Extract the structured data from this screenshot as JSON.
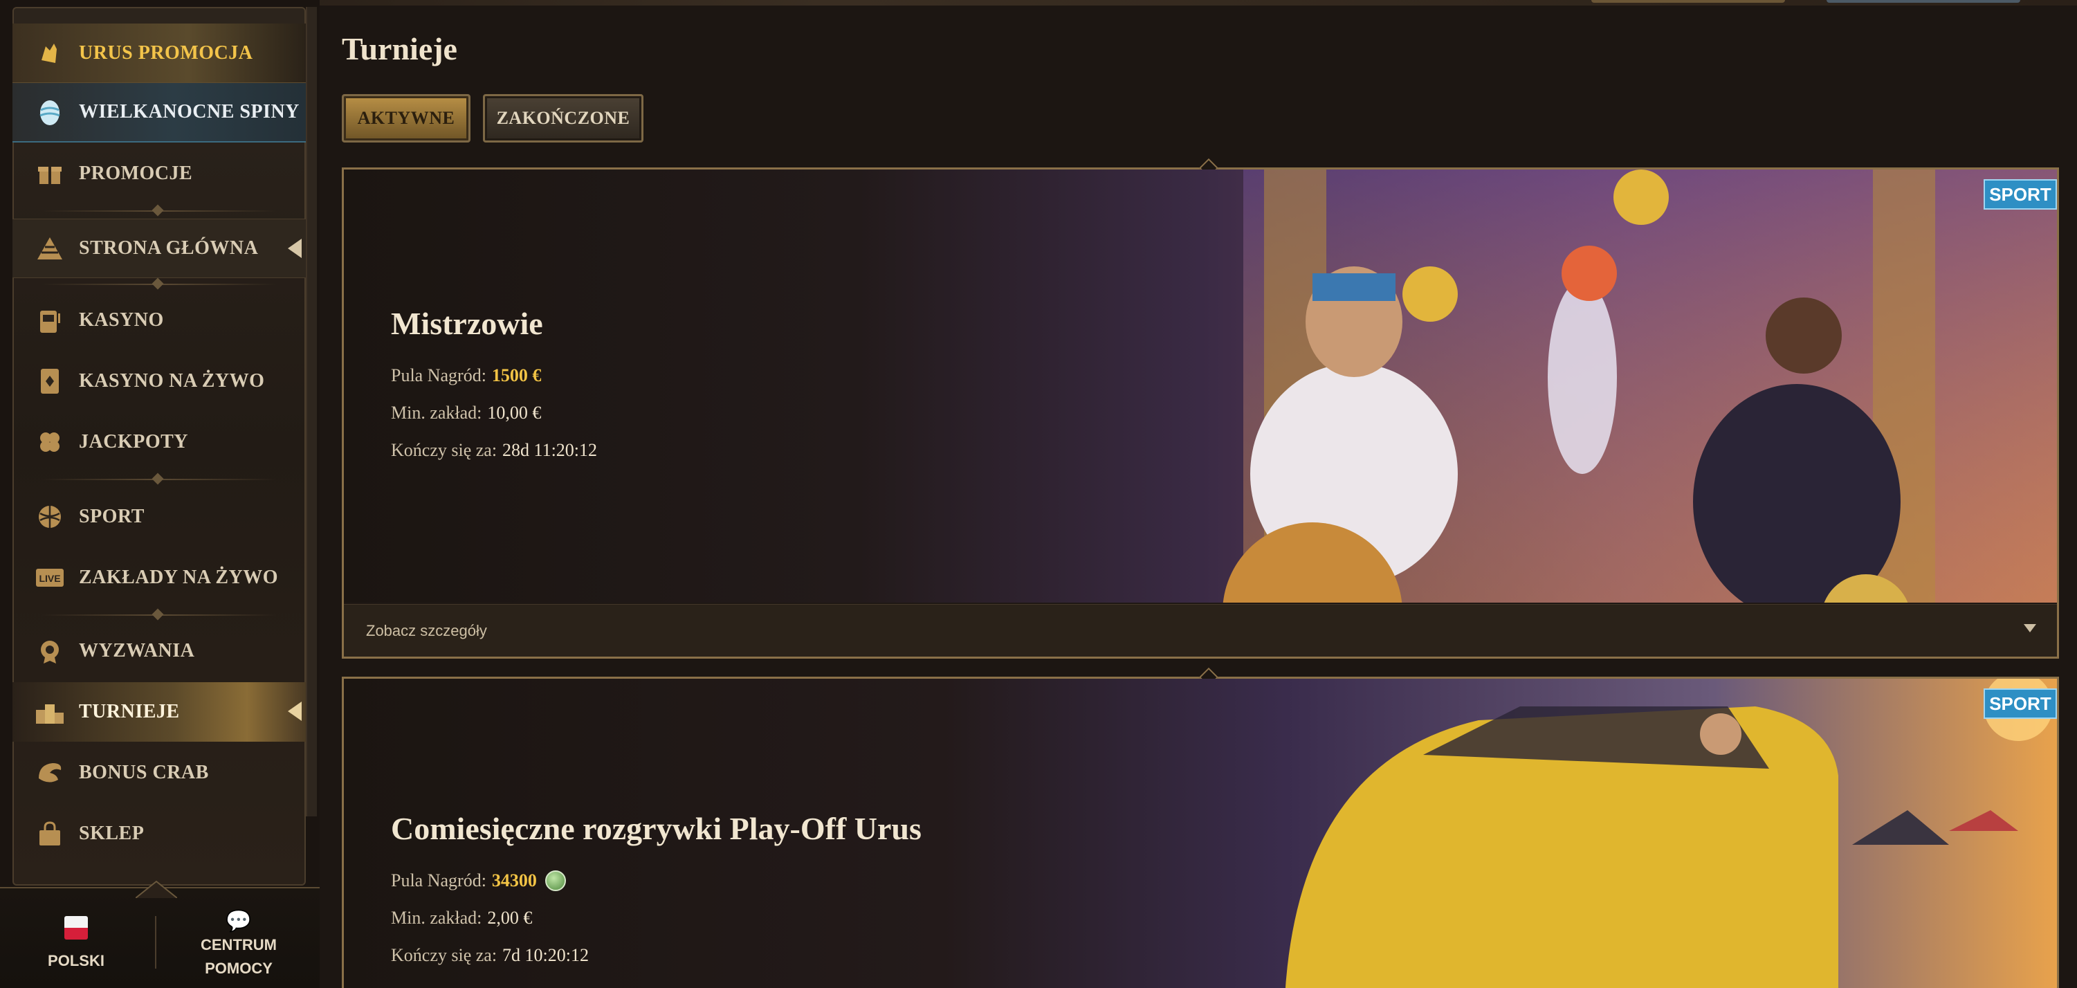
{
  "sidebar": {
    "items": [
      {
        "label": "URUS PROMOCJA",
        "icon": "bull-icon"
      },
      {
        "label": "WIELKANOCNE SPINY",
        "icon": "easter-egg-icon"
      },
      {
        "label": "PROMOCJE",
        "icon": "gift-icon"
      },
      {
        "label": "STRONA GŁÓWNA",
        "icon": "pyramid-icon"
      },
      {
        "label": "KASYNO",
        "icon": "slot-machine-icon"
      },
      {
        "label": "KASYNO NA ŻYWO",
        "icon": "playing-card-icon"
      },
      {
        "label": "JACKPOTY",
        "icon": "clover-icon"
      },
      {
        "label": "SPORT",
        "icon": "ball-icon"
      },
      {
        "label": "ZAKŁADY NA ŻYWO",
        "icon": "live-icon",
        "icon_text": "LIVE"
      },
      {
        "label": "WYZWANIA",
        "icon": "medal-icon"
      },
      {
        "label": "TURNIEJE",
        "icon": "podium-icon"
      },
      {
        "label": "BONUS CRAB",
        "icon": "crab-claw-icon"
      },
      {
        "label": "SKLEP",
        "icon": "shop-bag-icon"
      }
    ],
    "footer": {
      "language": "POLSKI",
      "help": "CENTRUM POMOCY"
    }
  },
  "main": {
    "title": "Turnieje",
    "tabs": [
      {
        "label": "AKTYWNE",
        "active": true
      },
      {
        "label": "ZAKOŃCZONE",
        "active": false
      }
    ],
    "tournaments": [
      {
        "badge": "SPORT",
        "title": "Mistrzowie",
        "prize_label": "Pula Nagród:",
        "prize_value": "1500 €",
        "min_bet_label": "Min. zakład:",
        "min_bet_value": "10,00 €",
        "ends_label": "Kończy się za:",
        "ends_value": "28d 11:20:12",
        "details_label": "Zobacz szczegóły"
      },
      {
        "badge": "SPORT",
        "title": "Comiesięczne rozgrywki Play-Off Urus",
        "prize_label": "Pula Nagród:",
        "prize_value": "34300",
        "min_bet_label": "Min. zakład:",
        "min_bet_value": "2,00 €",
        "ends_label": "Kończy się za:",
        "ends_value": "7d 10:20:12"
      }
    ]
  },
  "colors": {
    "accent_gold": "#f2c345",
    "badge_blue": "#2e8fc4",
    "background": "#1c1612"
  }
}
